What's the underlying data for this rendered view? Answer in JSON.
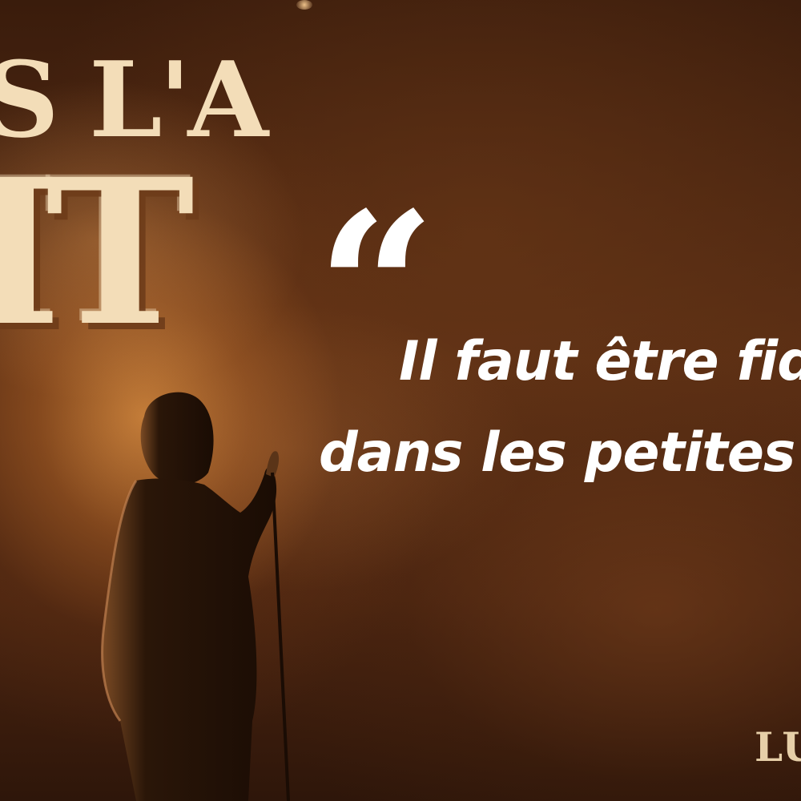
{
  "image": {
    "palette": {
      "background_dark": "#2a1408",
      "background_warm": "#5a2e14",
      "light_glow": "#d68a3e",
      "logo_cream": "#f3ddb8",
      "quote_text": "#ffffff"
    },
    "logo": {
      "line1": "S L'A",
      "line2": "IT"
    },
    "quote": {
      "mark": "“",
      "line1": "Il faut être fid",
      "line2": "dans les petites c"
    },
    "signature": "LU"
  }
}
